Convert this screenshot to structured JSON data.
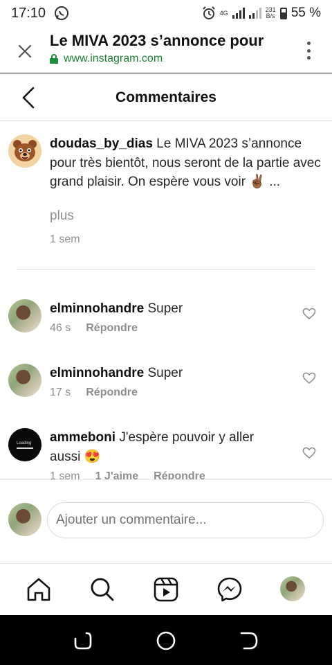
{
  "status_bar": {
    "time": "17:10",
    "network_label": "4G",
    "speed_value": "231",
    "speed_unit": "B/s",
    "battery": "55 %"
  },
  "browser": {
    "title": "Le MIVA 2023 s’annonce pour",
    "url": "www.instagram.com"
  },
  "header": {
    "title": "Commentaires"
  },
  "caption": {
    "username": "doudas_by_dias",
    "text": "Le MIVA 2023 s’annonce pour très bientôt, nous seront de la partie avec grand plaisir. On espère vous voir ✌🏾 ...",
    "more": "plus",
    "time": "1 sem"
  },
  "comments": [
    {
      "username": "elminnohandre",
      "text": "Super",
      "time": "46 s",
      "reply": "Répondre"
    },
    {
      "username": "elminnohandre",
      "text": "Super",
      "time": "17 s",
      "reply": "Répondre"
    },
    {
      "username": "ammeboni",
      "text": "J'espère pouvoir y aller aussi 😍",
      "time": "1 sem",
      "likes": "1 J'aime",
      "reply": "Répondre",
      "avatar_text": "Loading"
    }
  ],
  "composer": {
    "placeholder": "Ajouter un commentaire..."
  },
  "icons": {
    "browser_close": "close-icon",
    "browser_menu": "more-vertical-icon",
    "back": "chevron-left-icon",
    "like": "heart-icon",
    "nav": [
      "home-icon",
      "search-icon",
      "reels-icon",
      "messenger-icon",
      "profile-avatar"
    ],
    "system": [
      "recents-icon",
      "home-circle-icon",
      "back-icon"
    ]
  },
  "colors": {
    "url_green": "#1a7f2e",
    "muted_text": "#8e8e8e",
    "system_bar": "#000000"
  }
}
